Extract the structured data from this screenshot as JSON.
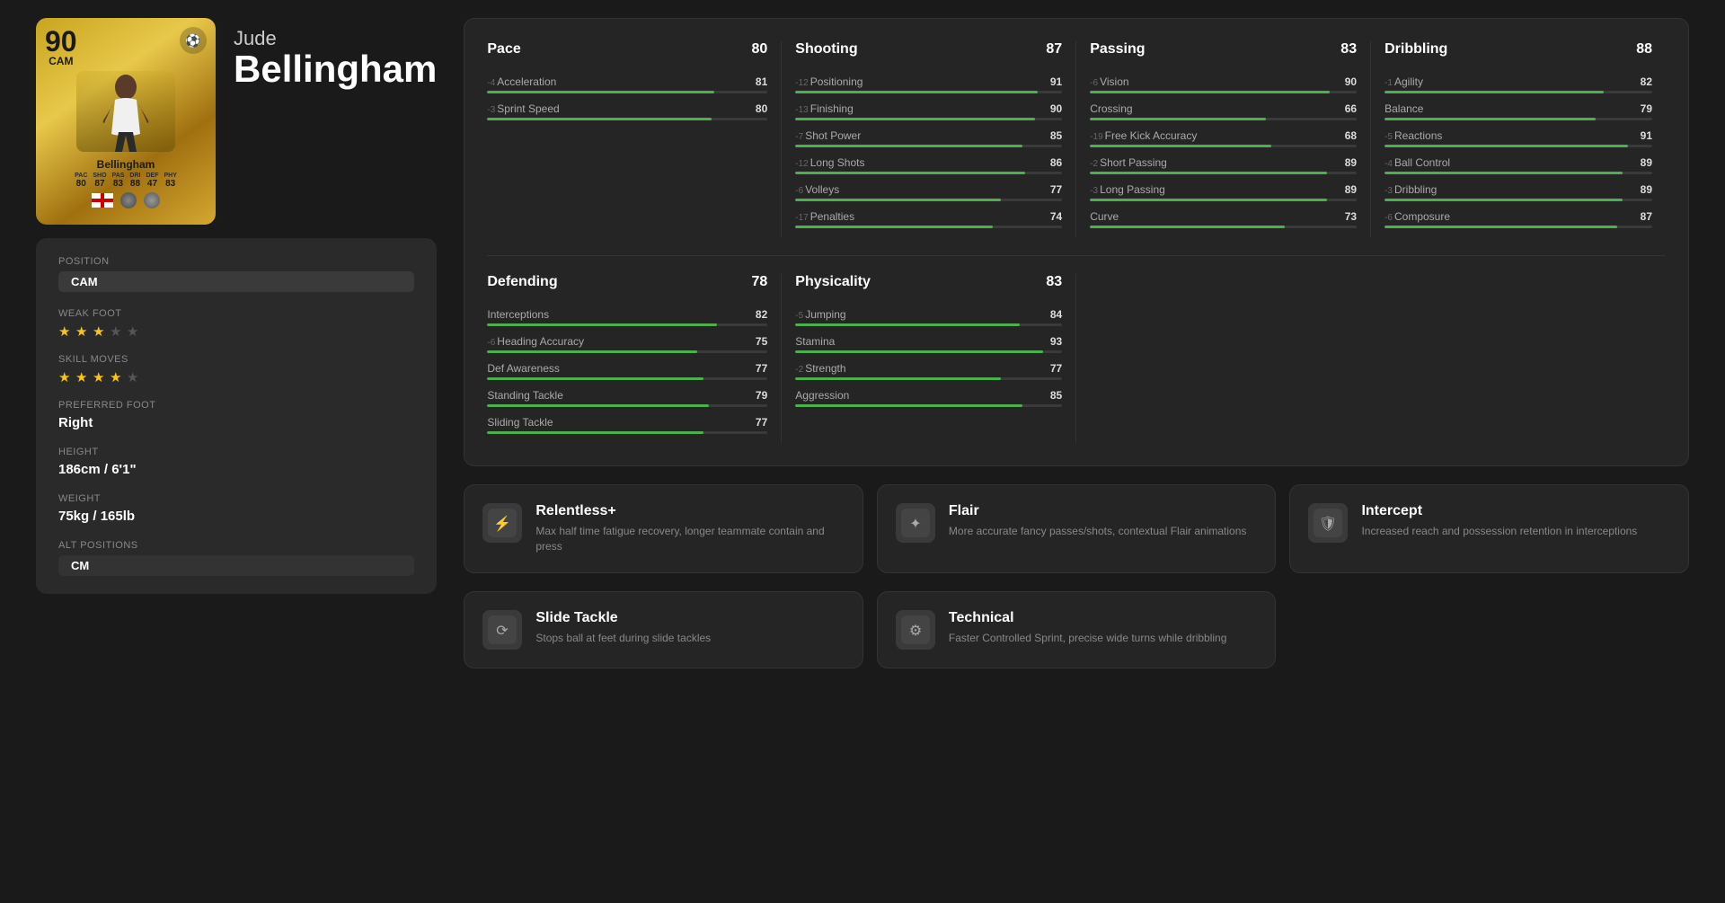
{
  "player": {
    "first_name": "Jude",
    "last_name": "Bellingham",
    "rating": "90",
    "position": "CAM",
    "card_name": "Bellingham",
    "card_stats": {
      "pac_label": "PAC",
      "pac": "80",
      "sho_label": "SHO",
      "sho": "87",
      "pas_label": "PAS",
      "pas": "83",
      "dri_label": "DRI",
      "dri": "88",
      "def_label": "DEF",
      "def": "47",
      "phy_label": "PHY",
      "phy": "83"
    }
  },
  "info": {
    "position_label": "Position",
    "position_value": "CAM",
    "weak_foot_label": "Weak Foot",
    "weak_foot_stars": 3,
    "weak_foot_max": 5,
    "skill_moves_label": "Skill Moves",
    "skill_moves_stars": 4,
    "skill_moves_max": 5,
    "preferred_foot_label": "Preferred Foot",
    "preferred_foot_value": "Right",
    "height_label": "Height",
    "height_value": "186cm / 6'1\"",
    "weight_label": "Weight",
    "weight_value": "75kg / 165lb",
    "alt_positions_label": "Alt Positions",
    "alt_position_value": "CM"
  },
  "stats": {
    "pace": {
      "name": "Pace",
      "value": 80,
      "items": [
        {
          "name": "Acceleration",
          "value": 81,
          "modifier": "-4",
          "bar": 81
        },
        {
          "name": "Sprint Speed",
          "value": 80,
          "modifier": "-3",
          "bar": 80
        }
      ]
    },
    "shooting": {
      "name": "Shooting",
      "value": 87,
      "items": [
        {
          "name": "Positioning",
          "value": 91,
          "modifier": "-12",
          "bar": 91
        },
        {
          "name": "Finishing",
          "value": 90,
          "modifier": "-13",
          "bar": 90
        },
        {
          "name": "Shot Power",
          "value": 85,
          "modifier": "-7",
          "bar": 85
        },
        {
          "name": "Long Shots",
          "value": 86,
          "modifier": "-12",
          "bar": 86
        },
        {
          "name": "Volleys",
          "value": 77,
          "modifier": "-6",
          "bar": 77
        },
        {
          "name": "Penalties",
          "value": 74,
          "modifier": "-17",
          "bar": 74
        }
      ]
    },
    "passing": {
      "name": "Passing",
      "value": 83,
      "items": [
        {
          "name": "Vision",
          "value": 90,
          "modifier": "-6",
          "bar": 90
        },
        {
          "name": "Crossing",
          "value": 66,
          "modifier": "",
          "bar": 66
        },
        {
          "name": "Free Kick Accuracy",
          "value": 68,
          "modifier": "-19",
          "bar": 68
        },
        {
          "name": "Short Passing",
          "value": 89,
          "modifier": "-2",
          "bar": 89
        },
        {
          "name": "Long Passing",
          "value": 89,
          "modifier": "-3",
          "bar": 89
        },
        {
          "name": "Curve",
          "value": 73,
          "modifier": "",
          "bar": 73
        }
      ]
    },
    "dribbling": {
      "name": "Dribbling",
      "value": 88,
      "items": [
        {
          "name": "Agility",
          "value": 82,
          "modifier": "-1",
          "bar": 82
        },
        {
          "name": "Balance",
          "value": 79,
          "modifier": "",
          "bar": 79
        },
        {
          "name": "Reactions",
          "value": 91,
          "modifier": "-5",
          "bar": 91
        },
        {
          "name": "Ball Control",
          "value": 89,
          "modifier": "-4",
          "bar": 89
        },
        {
          "name": "Dribbling",
          "value": 89,
          "modifier": "-3",
          "bar": 89
        },
        {
          "name": "Composure",
          "value": 87,
          "modifier": "-6",
          "bar": 87
        }
      ]
    },
    "defending": {
      "name": "Defending",
      "value": 78,
      "items": [
        {
          "name": "Interceptions",
          "value": 82,
          "modifier": "",
          "bar": 82
        },
        {
          "name": "Heading Accuracy",
          "value": 75,
          "modifier": "-6",
          "bar": 75
        },
        {
          "name": "Def Awareness",
          "value": 77,
          "modifier": "",
          "bar": 77
        },
        {
          "name": "Standing Tackle",
          "value": 79,
          "modifier": "",
          "bar": 79
        },
        {
          "name": "Sliding Tackle",
          "value": 77,
          "modifier": "",
          "bar": 77
        }
      ]
    },
    "physicality": {
      "name": "Physicality",
      "value": 83,
      "items": [
        {
          "name": "Jumping",
          "value": 84,
          "modifier": "-5",
          "bar": 84
        },
        {
          "name": "Stamina",
          "value": 93,
          "modifier": "",
          "bar": 93
        },
        {
          "name": "Strength",
          "value": 77,
          "modifier": "-2",
          "bar": 77
        },
        {
          "name": "Aggression",
          "value": 85,
          "modifier": "",
          "bar": 85
        }
      ]
    }
  },
  "traits": [
    {
      "icon": "⚡",
      "name": "Relentless+",
      "desc": "Max half time fatigue recovery, longer teammate contain and press"
    },
    {
      "icon": "✦",
      "name": "Flair",
      "desc": "More accurate fancy passes/shots, contextual Flair animations"
    },
    {
      "icon": "🛡",
      "name": "Intercept",
      "desc": "Increased reach and possession retention in interceptions"
    },
    {
      "icon": "⟳",
      "name": "Slide Tackle",
      "desc": "Stops ball at feet during slide tackles"
    },
    {
      "icon": "⚙",
      "name": "Technical",
      "desc": "Faster Controlled Sprint, precise wide turns while dribbling"
    }
  ]
}
